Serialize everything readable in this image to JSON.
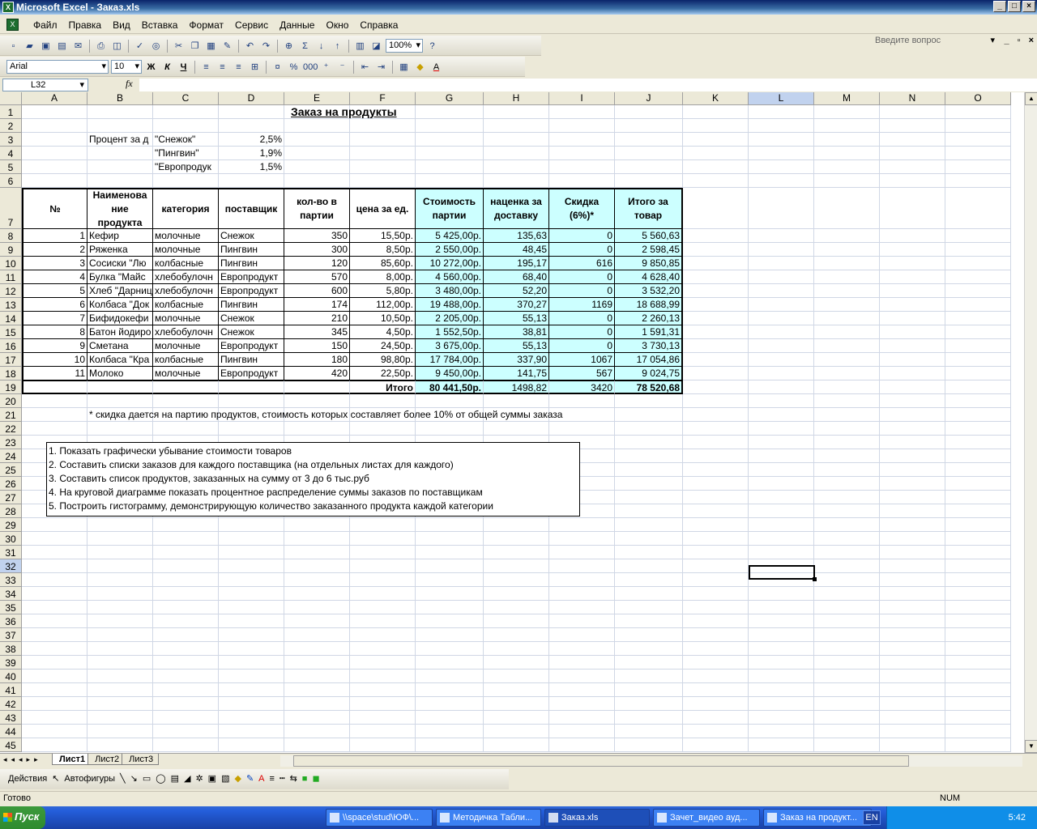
{
  "window": {
    "title": "Microsoft Excel - Заказ.xls"
  },
  "menu": {
    "items": [
      "Файл",
      "Правка",
      "Вид",
      "Вставка",
      "Формат",
      "Сервис",
      "Данные",
      "Окно",
      "Справка"
    ],
    "ask_placeholder": "Введите вопрос"
  },
  "toolbar": {
    "zoom": "100%",
    "font_name": "Arial",
    "font_size": "10",
    "bold": "Ж",
    "italic": "К",
    "underline": "Ч"
  },
  "formula_bar": {
    "cell_ref": "L32",
    "fx": "fx",
    "content": ""
  },
  "columns": [
    "A",
    "B",
    "C",
    "D",
    "E",
    "F",
    "G",
    "H",
    "I",
    "J",
    "K",
    "L",
    "M",
    "N",
    "O"
  ],
  "sheet": {
    "title": "Заказ на продукты",
    "percent_label": "Процент за д",
    "suppliers": [
      {
        "name": "\"Снежок\"",
        "pct": "2,5%"
      },
      {
        "name": "\"Пингвин\"",
        "pct": "1,9%"
      },
      {
        "name": "\"Европродук",
        "pct": "1,5%"
      }
    ],
    "headers": {
      "num": "№",
      "name": [
        "Наименова",
        "ние",
        "продукта"
      ],
      "category": "категория",
      "supplier": "поставщик",
      "qty": [
        "кол-во в",
        "партии"
      ],
      "price": "цена за ед.",
      "cost": [
        "Стоимость",
        "партии"
      ],
      "markup": [
        "наценка за",
        "доставку"
      ],
      "discount": [
        "Скидка",
        "(6%)*"
      ],
      "total": [
        "Итого за",
        "товар"
      ]
    },
    "rows": [
      [
        "1",
        "Кефир",
        "молочные",
        "Снежок",
        "350",
        "15,50р.",
        "5 425,00р.",
        "135,63",
        "0",
        "5 560,63"
      ],
      [
        "2",
        "Ряженка",
        "молочные",
        "Пингвин",
        "300",
        "8,50р.",
        "2 550,00р.",
        "48,45",
        "0",
        "2 598,45"
      ],
      [
        "3",
        "Сосиски \"Лю",
        "колбасные",
        "Пингвин",
        "120",
        "85,60р.",
        "10 272,00р.",
        "195,17",
        "616",
        "9 850,85"
      ],
      [
        "4",
        "Булка \"Майс",
        "хлебобулочн",
        "Европродукт",
        "570",
        "8,00р.",
        "4 560,00р.",
        "68,40",
        "0",
        "4 628,40"
      ],
      [
        "5",
        "Хлеб \"Дарниц",
        "хлебобулочн",
        "Европродукт",
        "600",
        "5,80р.",
        "3 480,00р.",
        "52,20",
        "0",
        "3 532,20"
      ],
      [
        "6",
        "Колбаса \"Док",
        "колбасные",
        "Пингвин",
        "174",
        "112,00р.",
        "19 488,00р.",
        "370,27",
        "1169",
        "18 688,99"
      ],
      [
        "7",
        "Бифидокефи",
        "молочные",
        "Снежок",
        "210",
        "10,50р.",
        "2 205,00р.",
        "55,13",
        "0",
        "2 260,13"
      ],
      [
        "8",
        "Батон йодиро",
        "хлебобулочн",
        "Снежок",
        "345",
        "4,50р.",
        "1 552,50р.",
        "38,81",
        "0",
        "1 591,31"
      ],
      [
        "9",
        "Сметана",
        "молочные",
        "Европродукт",
        "150",
        "24,50р.",
        "3 675,00р.",
        "55,13",
        "0",
        "3 730,13"
      ],
      [
        "10",
        "Колбаса \"Кра",
        "колбасные",
        "Пингвин",
        "180",
        "98,80р.",
        "17 784,00р.",
        "337,90",
        "1067",
        "17 054,86"
      ],
      [
        "11",
        "Молоко",
        "молочные",
        "Европродукт",
        "420",
        "22,50р.",
        "9 450,00р.",
        "141,75",
        "567",
        "9 024,75"
      ]
    ],
    "totals": {
      "label": "Итого",
      "cost": "80 441,50р.",
      "markup": "1498,82",
      "discount": "3420",
      "total": "78 520,68"
    },
    "footnote": "* скидка дается на партию продуктов, стоимость которых составляет более 10% от общей суммы заказа",
    "tasks": [
      "1. Показать графически убывание стоимости товаров",
      "2. Составить списки заказов для каждого поставщика (на отдельных листах для каждого)",
      "3. Составить список продуктов, заказанных на сумму от 3 до 6 тыс.руб",
      "4. На круговой диаграмме показать процентное распределение суммы заказов по поставщикам",
      "5. Построить гистограмму, демонстрирующую количество заказанного продукта каждой категории"
    ]
  },
  "tabs": [
    "Лист1",
    "Лист2",
    "Лист3"
  ],
  "drawing": {
    "actions": "Действия",
    "autoshapes": "Автофигуры"
  },
  "status": {
    "left": "Готово",
    "num": "NUM"
  },
  "taskbar": {
    "start": "Пуск",
    "buttons": [
      "\\\\space\\stud\\ЮФ\\...",
      "Методичка Табли...",
      "Заказ.xls",
      "Зачет_видео ауд...",
      "Заказ на продукт..."
    ],
    "lang": "EN",
    "clock": "5:42"
  }
}
